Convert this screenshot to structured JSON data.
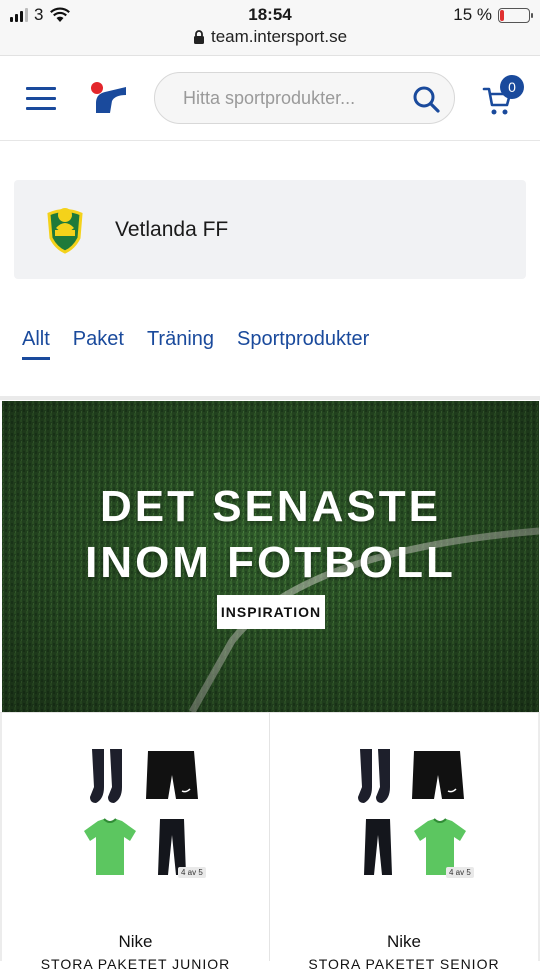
{
  "status_bar": {
    "carrier": "3",
    "time": "18:54",
    "battery": "15 %",
    "battery_level": 0.15
  },
  "browser": {
    "url": "team.intersport.se"
  },
  "header": {
    "search_placeholder": "Hitta sportprodukter...",
    "cart_count": "0"
  },
  "club": {
    "name": "Vetlanda FF"
  },
  "tabs": [
    {
      "label": "Allt",
      "active": true
    },
    {
      "label": "Paket",
      "active": false
    },
    {
      "label": "Träning",
      "active": false
    },
    {
      "label": "Sportprodukter",
      "active": false
    }
  ],
  "banner": {
    "title_line1": "DET SENASTE",
    "title_line2": "INOM FOTBOLL",
    "tag": "INSPIRATION"
  },
  "products": [
    {
      "brand": "Nike",
      "name": "STORA PAKETET JUNIOR",
      "count_badge": "4 av 5"
    },
    {
      "brand": "Nike",
      "name": "STORA PAKETET SENIOR",
      "count_badge": "4 av 5"
    }
  ],
  "colors": {
    "brand_blue": "#1a4a9c",
    "brand_red": "#e3262b"
  }
}
